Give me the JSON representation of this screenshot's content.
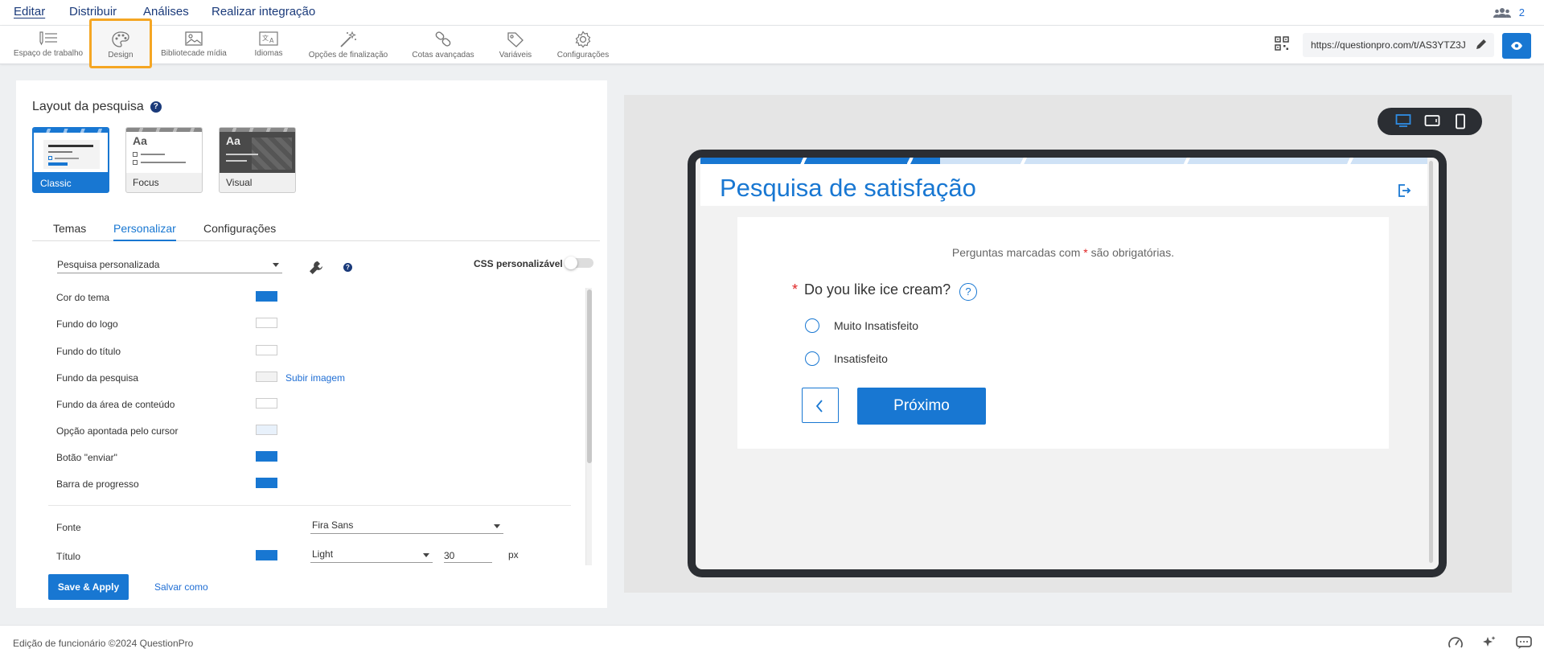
{
  "menu": {
    "items": [
      "Editar",
      "Distribuir",
      "Análises",
      "Realizar integração"
    ],
    "active": "Editar",
    "collaborators_count": "2"
  },
  "toolbar": {
    "tools": [
      {
        "label": "Espaço de trabalho",
        "icon": "workspace-icon"
      },
      {
        "label": "Design",
        "icon": "palette-icon",
        "active": true
      },
      {
        "label": "Bibliotecade mídia",
        "icon": "image-icon"
      },
      {
        "label": "Idiomas",
        "icon": "translate-icon"
      },
      {
        "label": "Opções de finalização",
        "icon": "magic-wand-icon"
      },
      {
        "label": "Cotas avançadas",
        "icon": "link-icon"
      },
      {
        "label": "Variáveis",
        "icon": "tag-icon"
      },
      {
        "label": "Configurações",
        "icon": "gear-icon"
      }
    ],
    "survey_url": "https://questionpro.com/t/AS3YTZ3J"
  },
  "layout": {
    "title": "Layout da pesquisa",
    "options": [
      {
        "label": "Classic",
        "active": true,
        "badge": ""
      },
      {
        "label": "Focus",
        "active": false,
        "badge": "Aa"
      },
      {
        "label": "Visual",
        "active": false,
        "badge": "Aa"
      }
    ]
  },
  "tabs": {
    "items": [
      "Temas",
      "Personalizar",
      "Configurações"
    ],
    "active": "Personalizar"
  },
  "customize": {
    "theme_select_value": "Pesquisa personalizada",
    "css_label": "CSS personalizável",
    "css_enabled": false,
    "colors": [
      {
        "label": "Cor do tema",
        "color": "#1877d2"
      },
      {
        "label": "Fundo do logo",
        "color": "#ffffff"
      },
      {
        "label": "Fundo do título",
        "color": "#ffffff"
      },
      {
        "label": "Fundo da pesquisa",
        "color": "#f2f2f2",
        "link": "Subir imagem"
      },
      {
        "label": "Fundo da área de conteúdo",
        "color": "#ffffff"
      },
      {
        "label": "Opção apontada pelo cursor",
        "color": "#e8f1fb"
      },
      {
        "label": "Botão \"enviar\"",
        "color": "#1877d2"
      },
      {
        "label": "Barra de progresso",
        "color": "#1877d2"
      }
    ],
    "font": {
      "label": "Fonte",
      "value": "Fira Sans"
    },
    "title_font": {
      "label": "Título",
      "color": "#1877d2",
      "weight": "Light",
      "size": "30",
      "unit": "px"
    }
  },
  "actions": {
    "save_apply": "Save & Apply",
    "save_as": "Salvar como"
  },
  "preview": {
    "survey_title": "Pesquisa de satisfação",
    "progress_percent": 33,
    "required_note_prefix": "Perguntas marcadas com ",
    "required_note_star": "*",
    "required_note_suffix": " são obrigatórias.",
    "question_star": "*",
    "question": "Do you like ice cream?",
    "question_help": "?",
    "options": [
      "Muito Insatisfeito",
      "Insatisfeito"
    ],
    "next_button": "Próximo"
  },
  "footer": {
    "text": "Edição de funcionário ©2024 QuestionPro"
  }
}
